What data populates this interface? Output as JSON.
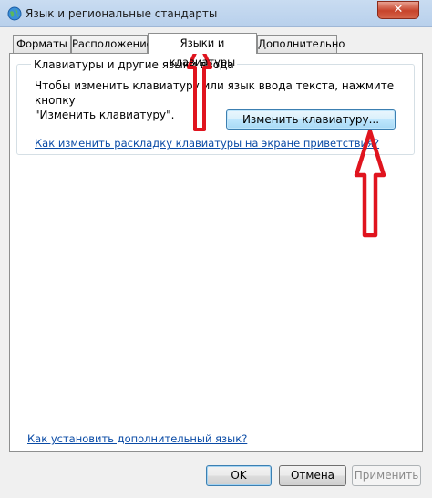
{
  "window": {
    "title": "Язык и региональные стандарты",
    "close_label": "✕"
  },
  "tabs": [
    {
      "label": "Форматы",
      "active": false
    },
    {
      "label": "Расположение",
      "active": false
    },
    {
      "label": "Языки и клавиатуры",
      "active": true
    },
    {
      "label": "Дополнительно",
      "active": false
    }
  ],
  "keyboards_group": {
    "title": "Клавиатуры и другие языки ввода",
    "description_line1": "Чтобы изменить клавиатуру или язык ввода текста, нажмите кнопку",
    "description_line2": "\"Изменить клавиатуру\".",
    "change_button": "Изменить клавиатуру...",
    "welcome_link": "Как изменить раскладку клавиатуры на экране приветствия?"
  },
  "install_link": "Как установить дополнительный язык?",
  "buttons": {
    "ok": "OK",
    "cancel": "Отмена",
    "apply": "Применить"
  },
  "colors": {
    "annotation_arrow": "#e0141e",
    "link": "#0a4ba6"
  }
}
